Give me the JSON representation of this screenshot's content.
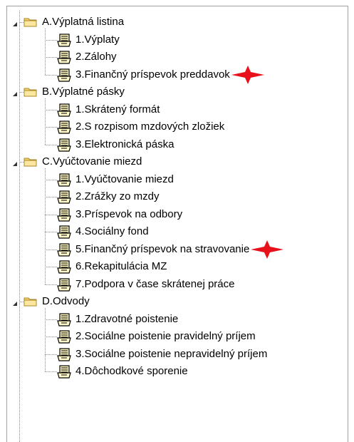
{
  "tree": {
    "groups": [
      {
        "label": "A.Výplatná listina",
        "expanded": true,
        "items": [
          {
            "label": "1.Výplaty",
            "marked": false
          },
          {
            "label": "2.Zálohy",
            "marked": false
          },
          {
            "label": "3.Finančný príspevok preddavok",
            "marked": true
          }
        ]
      },
      {
        "label": "B.Výplatné pásky",
        "expanded": true,
        "items": [
          {
            "label": "1.Skrátený formát",
            "marked": false
          },
          {
            "label": "2.S rozpisom mzdových zložiek",
            "marked": false
          },
          {
            "label": "3.Elektronická páska",
            "marked": false
          }
        ]
      },
      {
        "label": "C.Vyúčtovanie miezd",
        "expanded": true,
        "items": [
          {
            "label": "1.Vyúčtovanie miezd",
            "marked": false
          },
          {
            "label": "2.Zrážky zo mzdy",
            "marked": false
          },
          {
            "label": "3.Príspevok na odbory",
            "marked": false
          },
          {
            "label": "4.Sociálny fond",
            "marked": false
          },
          {
            "label": "5.Finančný príspevok na stravovanie",
            "marked": true
          },
          {
            "label": "6.Rekapitulácia MZ",
            "marked": false
          },
          {
            "label": "7.Podpora v čase skrátenej práce",
            "marked": false
          }
        ]
      },
      {
        "label": "D.Odvody",
        "expanded": true,
        "items": [
          {
            "label": "1.Zdravotné poistenie",
            "marked": false
          },
          {
            "label": "2.Sociálne poistenie pravidelný príjem",
            "marked": false
          },
          {
            "label": "3.Sociálne poistenie nepravidelný príjem",
            "marked": false
          },
          {
            "label": "4.Dôchodkové sporenie",
            "marked": false
          }
        ]
      }
    ]
  },
  "colors": {
    "marker": "#e8101a",
    "folder": "#f3d26a",
    "folder_border": "#a88a2a",
    "page_fill": "#f7efb8"
  },
  "icons": {
    "expander": "expanded-triangle-icon",
    "group": "folder-icon",
    "item": "report-page-icon",
    "marker": "red-star-marker-icon"
  }
}
